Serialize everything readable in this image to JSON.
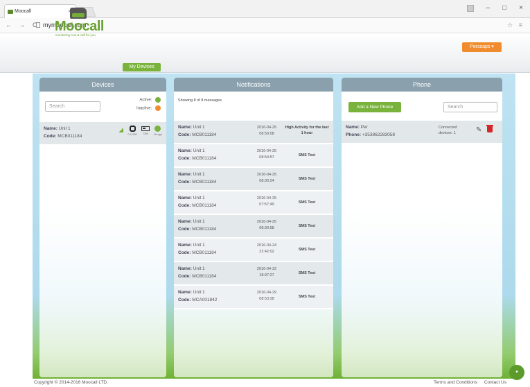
{
  "browser": {
    "tab_title": "Moocall",
    "tab_close": "×",
    "url": "mymoocall.com",
    "nav": "← → C",
    "tools": "☆ ≡"
  },
  "header": {
    "logo_name": "Moocall",
    "logo_tagline": "monitoring cow & calf for you",
    "nav_my_devices": "My Devices",
    "user_menu": "Perssaps ▾"
  },
  "devices": {
    "title": "Devices",
    "search_placeholder": "Search",
    "legend_active": "Active:",
    "legend_inactive": "Inactive:",
    "active_color": "#79b33c",
    "inactive_color": "#f08c2e",
    "items": [
      {
        "name_label": "Name:",
        "name": "Unit 1",
        "code_label": "Code:",
        "code": "MCB011184",
        "icon1_caption": "0.1.000",
        "icon2_caption": "73%",
        "icon3_caption": "1h ago"
      }
    ]
  },
  "notifications": {
    "title": "Notifications",
    "showing": "Showing 8 of 8 messages",
    "items": [
      {
        "name": "Unit 1",
        "code": "MCB011184",
        "date": "2016-04-25",
        "time": "08:50:08",
        "message": "High Activity for the last 1 hour"
      },
      {
        "name": "Unit 1",
        "code": "MCB011184",
        "date": "2016-04-25",
        "time": "08:54:57",
        "message": "SMS Test"
      },
      {
        "name": "Unit 1",
        "code": "MCB011184",
        "date": "2016-04-25",
        "time": "08:30:24",
        "message": "SMS Test"
      },
      {
        "name": "Unit 1",
        "code": "MCB011184",
        "date": "2016-04-25",
        "time": "07:57:49",
        "message": "SMS Test"
      },
      {
        "name": "Unit 1",
        "code": "MCB011184",
        "date": "2016-04-25",
        "time": "08:30:58",
        "message": "SMS Test"
      },
      {
        "name": "Unit 1",
        "code": "MCB011184",
        "date": "2016-04-24",
        "time": "22:42:02",
        "message": "SMS Test"
      },
      {
        "name": "Unit 1",
        "code": "MCB011184",
        "date": "2016-04-22",
        "time": "18:37:27",
        "message": "SMS Test"
      },
      {
        "name": "Unit 1",
        "code": "MCA001842",
        "date": "2016-04-29",
        "time": "08:53:28",
        "message": "SMS Test"
      }
    ],
    "name_label": "Name:",
    "code_label": "Code:"
  },
  "phone": {
    "title": "Phone",
    "add_button": "Add a New Phone",
    "search_placeholder": "Search",
    "items": [
      {
        "name_label": "Name:",
        "name": "Per",
        "phone_label": "Phone:",
        "phone": "+353862283058",
        "connected_label": "Connected",
        "connected_devices": "devices: 1"
      }
    ]
  },
  "footer": {
    "copyright": "Copyright © 2014-2016 Moocall LTD.",
    "terms": "Terms and Conditions",
    "contact": "Contact Us"
  }
}
